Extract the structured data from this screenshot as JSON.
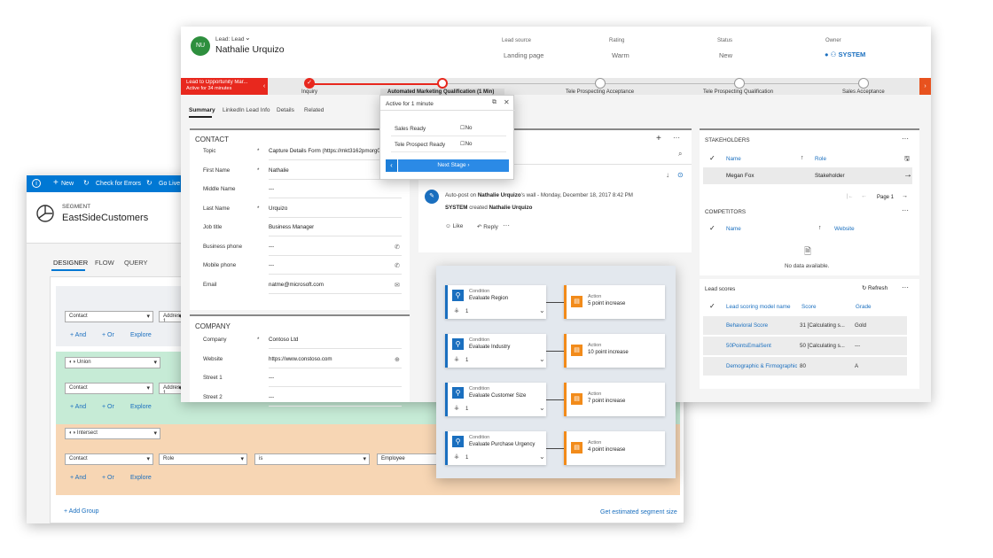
{
  "segment": {
    "toolbar": {
      "new": "New",
      "check": "Check for Errors",
      "golive": "Go Live"
    },
    "label": "SEGMENT",
    "name": "EastSideCustomers",
    "tabs": [
      "DESIGNER",
      "FLOW",
      "QUERY"
    ],
    "group1": {
      "entity": "Contact",
      "field": "Address 1"
    },
    "ops": {
      "and": "And",
      "or": "Or",
      "explore": "Explore"
    },
    "union": "Union",
    "group2": {
      "entity": "Contact",
      "field": "Address 1"
    },
    "intersect": "Intersect",
    "group3": {
      "entity": "Contact",
      "field": "Role",
      "operator": "is",
      "value": "Employee"
    },
    "add_group": "Add Group",
    "estimate": "Get estimated segment size"
  },
  "lead": {
    "avatar": "NU",
    "type": "Lead: Lead",
    "name": "Nathalie Urquizo",
    "fields": [
      {
        "label": "Lead source",
        "value": "Landing page"
      },
      {
        "label": "Rating",
        "value": "Warm"
      },
      {
        "label": "Status",
        "value": "New"
      },
      {
        "label": "Owner",
        "value": "SYSTEM"
      }
    ],
    "bpf": {
      "name": "Lead to Opportunity Mar...",
      "active": "Active for 34 minutes",
      "stages": [
        "Inquiry",
        "Automated Marketing Qualification  (1 Min)",
        "Tele Prospecting Acceptance",
        "Tele Prospecting Qualification",
        "Sales Acceptance"
      ]
    },
    "flyout": {
      "title": "Active for 1 minute",
      "rows": [
        {
          "label": "Sales Ready",
          "value": "No"
        },
        {
          "label": "Tele Prospect Ready",
          "value": "No"
        }
      ],
      "next": "Next Stage"
    },
    "tabs": [
      "Summary",
      "LinkedIn Lead Info",
      "Details",
      "Related"
    ],
    "contact": {
      "title": "CONTACT",
      "rows": [
        {
          "label": "Topic",
          "req": "*",
          "value": "Capture Details Form (https://mkt3162pmorg0"
        },
        {
          "label": "First Name",
          "req": "*",
          "value": "Nathalie"
        },
        {
          "label": "Middle Name",
          "req": "",
          "value": "---"
        },
        {
          "label": "Last Name",
          "req": "*",
          "value": "Urquizo"
        },
        {
          "label": "Job title",
          "req": "",
          "value": "Business Manager"
        },
        {
          "label": "Business phone",
          "req": "",
          "value": "---"
        },
        {
          "label": "Mobile phone",
          "req": "",
          "value": "---"
        },
        {
          "label": "Email",
          "req": "",
          "value": "natme@microsoft.com"
        }
      ]
    },
    "company": {
      "title": "COMPANY",
      "rows": [
        {
          "label": "Company",
          "req": "*",
          "value": "Contoso Ltd"
        },
        {
          "label": "Website",
          "req": "",
          "value": "https://www.constoso.com"
        },
        {
          "label": "Street 1",
          "req": "",
          "value": "---"
        },
        {
          "label": "Street 2",
          "req": "",
          "value": "---"
        }
      ]
    },
    "post": {
      "prefix": "Auto-post on",
      "who": "Nathalie Urquizo",
      "suffix": "'s wall",
      "date": "Monday, December 18, 2017 8:42 PM",
      "system": "SYSTEM",
      "created": "created",
      "target": "Nathalie Urquizo",
      "like": "Like",
      "reply": "Reply"
    },
    "stakeholders": {
      "title": "STAKEHOLDERS",
      "col1": "Name",
      "col2": "Role",
      "name": "Megan Fox",
      "role": "Stakeholder",
      "page": "Page 1"
    },
    "competitors": {
      "title": "COMPETITORS",
      "col1": "Name",
      "col2": "Website",
      "empty": "No data available."
    },
    "leadscores": {
      "title": "Lead scores",
      "refresh": "Refresh",
      "cols": [
        "Lead scoring model name",
        "Score",
        "Grade"
      ],
      "rows": [
        {
          "name": "Behavioral Score",
          "score": "31 [Calculating s...",
          "grade": "Gold"
        },
        {
          "name": "50PointsEmaiSent",
          "score": "50 [Calculating s...",
          "grade": "---"
        },
        {
          "name": "Demographic & Firmographic",
          "score": "80",
          "grade": "A"
        }
      ]
    }
  },
  "scoring": {
    "rules": [
      {
        "cond_label": "Condition",
        "cond": "Evaluate Region",
        "count": "1",
        "act_label": "Action",
        "action": "5 point increase"
      },
      {
        "cond_label": "Condition",
        "cond": "Evaluate Industry",
        "count": "1",
        "act_label": "Action",
        "action": "10 point increase"
      },
      {
        "cond_label": "Condition",
        "cond": "Evaluate Customer Size",
        "count": "1",
        "act_label": "Action",
        "action": "7 point increase"
      },
      {
        "cond_label": "Condition",
        "cond": "Evaluate Purchase Urgency",
        "count": "1",
        "act_label": "Action",
        "action": "4 point increase"
      }
    ]
  },
  "colors": {
    "accent": "#0078d4",
    "bpf_red": "#e8281e",
    "union_green": "#c6ebd6",
    "intersect_orange": "#f7d6b4",
    "action_orange": "#f28b1a"
  }
}
